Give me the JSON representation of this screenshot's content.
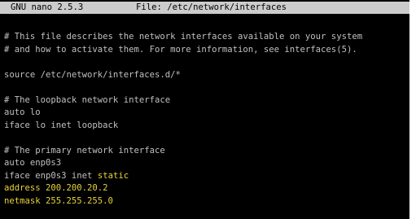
{
  "titlebar": {
    "app_version": "GNU nano 2.5.3",
    "file_label": "File: /etc/network/interfaces"
  },
  "buffer": {
    "lines": [
      "# This file describes the network interfaces available on your system",
      "# and how to activate them. For more information, see interfaces(5).",
      "",
      "source /etc/network/interfaces.d/*",
      "",
      "# The loopback network interface",
      "auto lo",
      "iface lo inet loopback",
      "",
      "# The primary network interface",
      "auto enp0s3",
      "iface enp0s3 inet ",
      "static",
      "address 200.200.20.2",
      "netmask 255.255.255.0"
    ]
  },
  "colors": {
    "background": "#000000",
    "text": "#c0c0c0",
    "highlight": "#e6d43a",
    "titlebar_bg": "#cccccc"
  }
}
